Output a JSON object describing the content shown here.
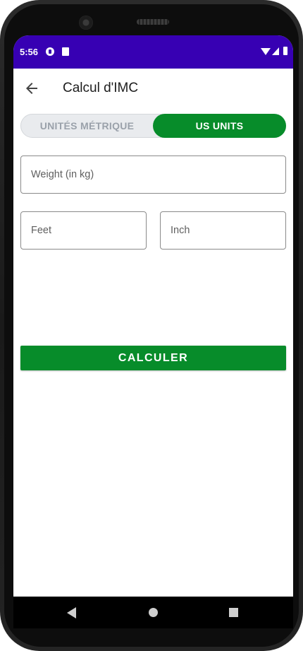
{
  "status_bar": {
    "time": "5:56",
    "background": "#3700b3",
    "left_icons": [
      "notification-app-icon",
      "sd-card-icon"
    ],
    "right_icons": [
      "wifi-icon",
      "signal-icon",
      "battery-icon"
    ]
  },
  "toolbar": {
    "title": "Calcul d'IMC",
    "back_icon": "arrow-left-icon"
  },
  "unit_toggle": {
    "options": [
      "UNITÉS MÉTRIQUE",
      "US UNITS"
    ],
    "selected": "US UNITS",
    "accent": "#078c2a"
  },
  "form": {
    "weight_placeholder": "Weight (in kg)",
    "weight_value": "",
    "feet_placeholder": "Feet",
    "feet_value": "",
    "inch_placeholder": "Inch",
    "inch_value": ""
  },
  "actions": {
    "calculate_label": "CALCULER"
  },
  "nav_bar": {
    "icons": [
      "back-triangle-icon",
      "home-circle-icon",
      "recents-square-icon"
    ]
  }
}
